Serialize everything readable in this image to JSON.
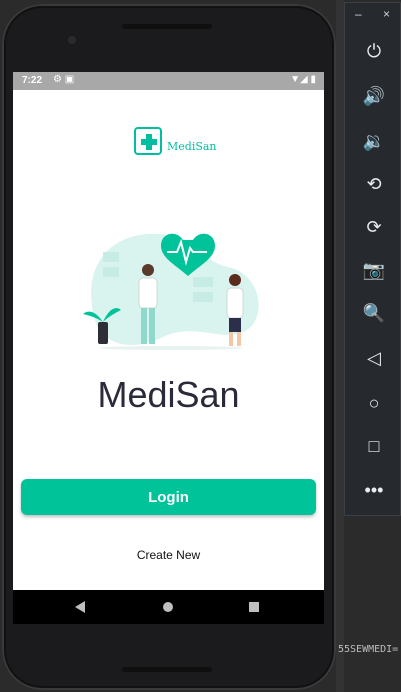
{
  "ide": {
    "bottom_text": "55SEWMEDI="
  },
  "statusbar": {
    "time": "7:22"
  },
  "app": {
    "logo_text": "MediSan",
    "title": "MediSan",
    "login_label": "Login",
    "create_label": "Create New",
    "accent_color": "#00c39a"
  },
  "emulator_panel": {
    "minimize": "–",
    "close": "×",
    "buttons": [
      {
        "icon": "power-icon"
      },
      {
        "icon": "volume-up-icon"
      },
      {
        "icon": "volume-down-icon"
      },
      {
        "icon": "rotate-left-icon"
      },
      {
        "icon": "rotate-right-icon"
      },
      {
        "icon": "camera-icon"
      },
      {
        "icon": "zoom-icon"
      },
      {
        "icon": "back-icon"
      },
      {
        "icon": "home-icon"
      },
      {
        "icon": "overview-icon"
      },
      {
        "icon": "more-icon"
      }
    ]
  }
}
